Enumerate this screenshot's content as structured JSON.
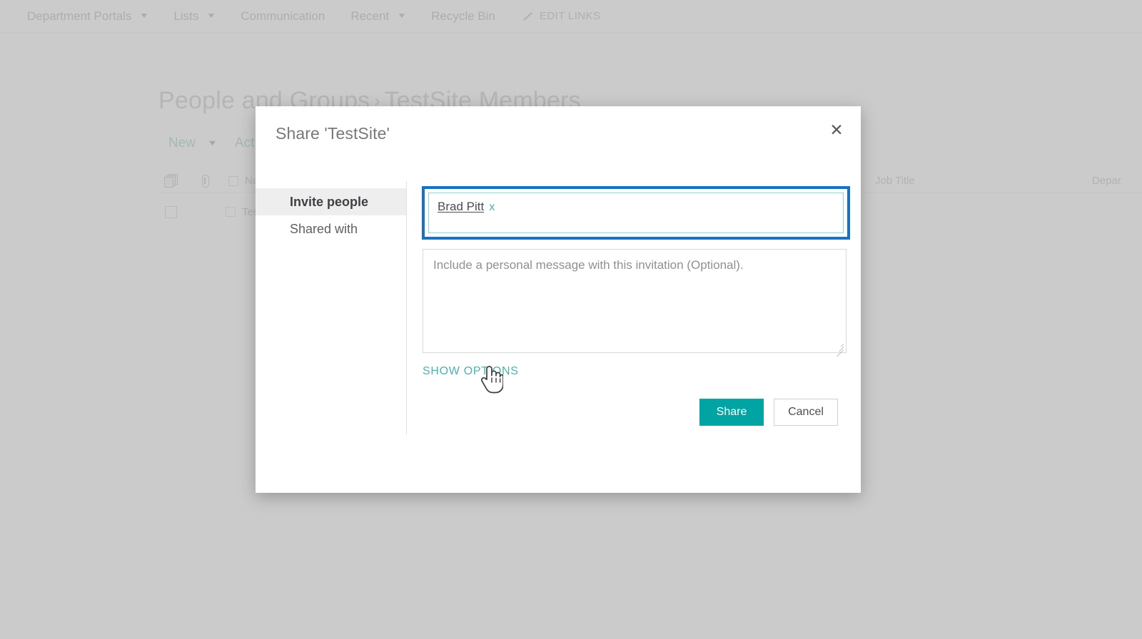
{
  "topnav": {
    "items": [
      {
        "label": "Department Portals",
        "caret": true
      },
      {
        "label": "Lists",
        "caret": true
      },
      {
        "label": "Communication",
        "caret": false
      },
      {
        "label": "Recent",
        "caret": true
      },
      {
        "label": "Recycle Bin",
        "caret": false
      }
    ],
    "edit_links": "EDIT LINKS"
  },
  "page": {
    "title_main": "People and Groups",
    "title_sep": "›",
    "title_sub": "TestSite Members",
    "commands": {
      "new": "New",
      "actions": "Act"
    },
    "list": {
      "columns": {
        "name": "Nam",
        "job_title": "Job Title",
        "department": "Depar"
      },
      "rows": [
        {
          "name": "Test"
        }
      ]
    }
  },
  "dialog": {
    "title": "Share 'TestSite'",
    "close_label": "✕",
    "tabs": [
      {
        "label": "Invite people",
        "active": true
      },
      {
        "label": "Shared with",
        "active": false
      }
    ],
    "picker": {
      "chip_name": "Brad Pitt",
      "chip_remove": "x"
    },
    "message": {
      "value": "",
      "placeholder": "Include a personal message with this invitation (Optional)."
    },
    "show_options": "SHOW OPTIONS",
    "buttons": {
      "share": "Share",
      "cancel": "Cancel"
    }
  },
  "colors": {
    "accent_teal": "#00a5a3",
    "link_teal": "#4bb3ae",
    "focus_blue": "#1673c4",
    "input_border_teal": "#8fd3d0"
  }
}
